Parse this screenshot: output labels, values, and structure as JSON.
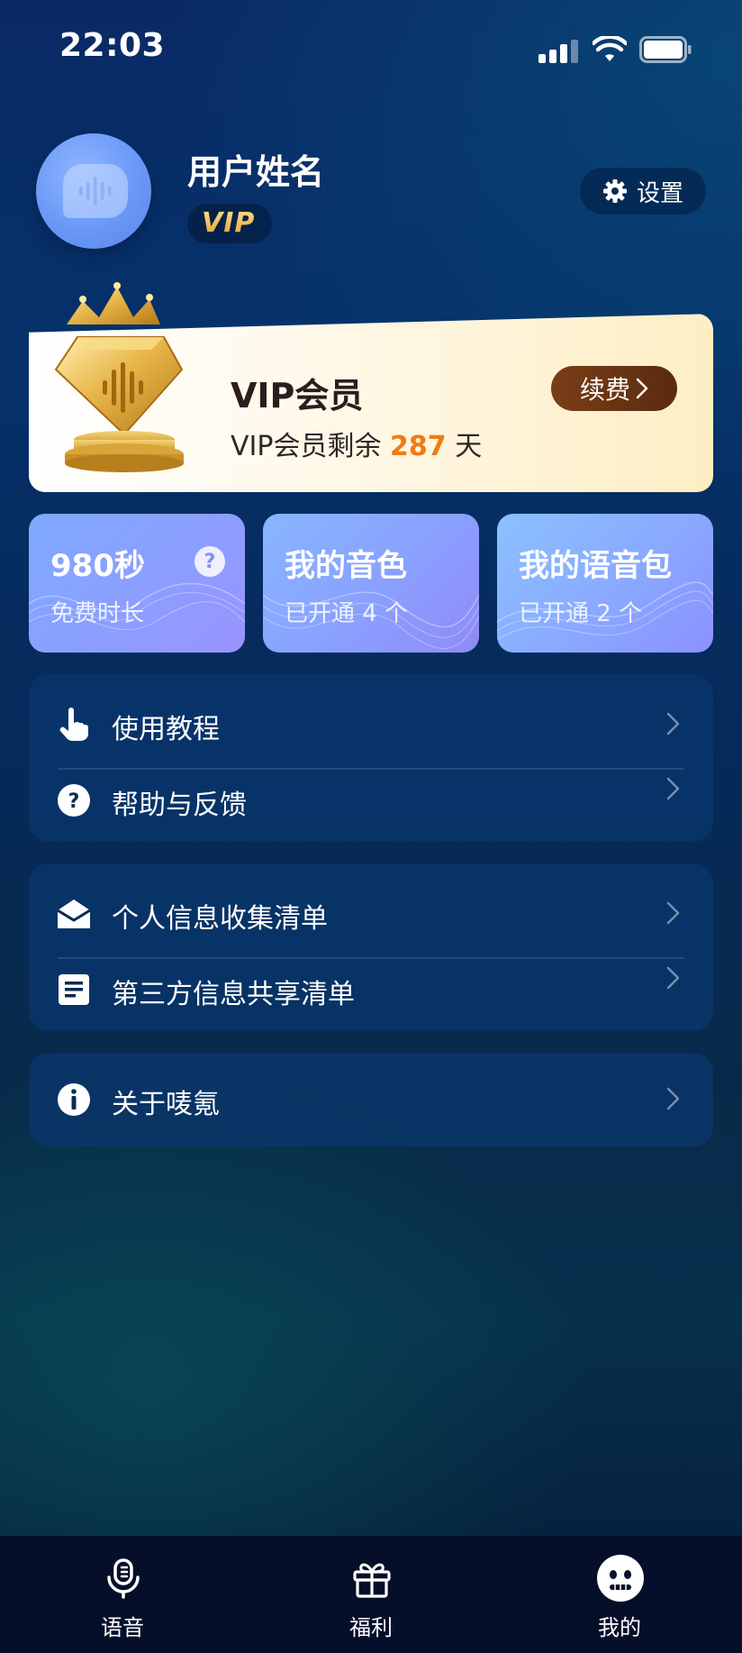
{
  "status_bar": {
    "time": "22:03"
  },
  "profile": {
    "name": "用户姓名",
    "badge": "VIP",
    "settings_label": "设置"
  },
  "vip_card": {
    "title": "VIP会员",
    "remaining_prefix": "VIP会员剩余",
    "remaining_days": "287",
    "remaining_unit": "天",
    "renew_label": "续费"
  },
  "stats": [
    {
      "title": "980秒",
      "subtitle": "免费时长"
    },
    {
      "title": "我的音色",
      "subtitle": "已开通 4 个"
    },
    {
      "title": "我的语音包",
      "subtitle": "已开通 2 个"
    }
  ],
  "menu": {
    "group1": [
      {
        "label": "使用教程",
        "icon": "pointer-hand-icon"
      },
      {
        "label": "帮助与反馈",
        "icon": "question-circle-icon"
      }
    ],
    "group2": [
      {
        "label": "个人信息收集清单",
        "icon": "open-envelope-icon"
      },
      {
        "label": "第三方信息共享清单",
        "icon": "document-icon"
      }
    ],
    "group3": [
      {
        "label": "关于唛氪",
        "icon": "info-circle-icon"
      }
    ]
  },
  "tabbar": {
    "items": [
      {
        "label": "语音",
        "icon": "microphone-icon",
        "active": false
      },
      {
        "label": "福利",
        "icon": "gift-icon",
        "active": false
      },
      {
        "label": "我的",
        "icon": "face-icon",
        "active": true
      }
    ]
  },
  "colors": {
    "accent_orange": "#f27a16",
    "renew_brown": "#7a3e17",
    "vip_gold": "#f4c14a"
  }
}
